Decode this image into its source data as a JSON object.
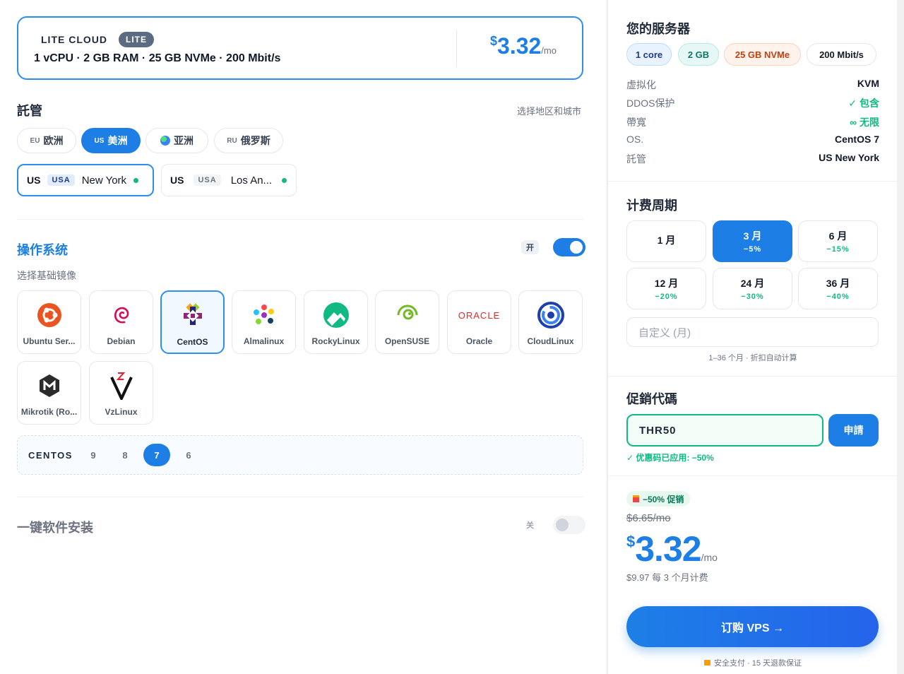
{
  "plan": {
    "name": "LITE CLOUD",
    "badge": "LITE",
    "specs": "1 vCPU · 2 GB RAM · 25 GB NVMe · 200 Mbit/s",
    "price_currency": "$",
    "price_amount": "3.32",
    "price_period": "/mo"
  },
  "hosting": {
    "title": "託管",
    "hint": "选择地区和城市",
    "regions": [
      {
        "code": "EU",
        "label": "欧洲",
        "active": false
      },
      {
        "code": "US",
        "label": "美洲",
        "active": true
      },
      {
        "code": "",
        "label": "亚洲",
        "active": false,
        "icon": "globe-icon"
      },
      {
        "code": "RU",
        "label": "俄罗斯",
        "active": false
      }
    ],
    "locations": [
      {
        "country": "US",
        "tag": "USA",
        "city": "New York",
        "active": true
      },
      {
        "country": "US",
        "tag": "USA",
        "city": "Los An...",
        "active": false
      }
    ]
  },
  "os": {
    "title": "操作系统",
    "toggle_label": "开",
    "toggle_on": true,
    "subtitle": "选择基础镜像",
    "items": [
      {
        "label": "Ubuntu Ser...",
        "icon": "ubuntu-icon"
      },
      {
        "label": "Debian",
        "icon": "debian-icon"
      },
      {
        "label": "CentOS",
        "icon": "centos-icon",
        "active": true
      },
      {
        "label": "Almalinux",
        "icon": "almalinux-icon"
      },
      {
        "label": "RockyLinux",
        "icon": "rockylinux-icon"
      },
      {
        "label": "OpenSUSE",
        "icon": "opensuse-icon"
      },
      {
        "label": "Oracle",
        "icon": "oracle-icon",
        "logo_text": "ORACLE"
      },
      {
        "label": "CloudLinux",
        "icon": "cloudlinux-icon"
      },
      {
        "label": "Mikrotik (Ro...",
        "icon": "mikrotik-icon"
      },
      {
        "label": "VzLinux",
        "icon": "vzlinux-icon"
      }
    ],
    "version_label": "CENTOS",
    "versions": [
      "9",
      "8",
      "7",
      "6"
    ],
    "selected_version": "7"
  },
  "software": {
    "title": "一键软件安装",
    "toggle_label": "关",
    "toggle_on": false
  },
  "summary": {
    "title": "您的服务器",
    "chips": [
      {
        "label": "1 core",
        "color": "#1e3a8a",
        "bg": "#e8f3ff",
        "border": "#bfdcfb"
      },
      {
        "label": "2 GB",
        "color": "#0f766e",
        "bg": "#e6f8f5",
        "border": "#b7ebe2"
      },
      {
        "label": "25 GB NVMe",
        "color": "#c2410c",
        "bg": "#fff3ec",
        "border": "#fbd3bd"
      },
      {
        "label": "200 Mbit/s",
        "color": "#111827",
        "bg": "#ffffff",
        "border": "#e5e7eb"
      }
    ],
    "rows": [
      {
        "key": "虚拟化",
        "value": "KVM",
        "green": false
      },
      {
        "key": "DDOS保护",
        "value": "✓ 包含",
        "green": true
      },
      {
        "key": "帶寬",
        "value": "∞ 无限",
        "green": true
      },
      {
        "key": "OS.",
        "value": "CentOS 7",
        "green": false
      },
      {
        "key": "託管",
        "value": "US New York",
        "green": false
      }
    ]
  },
  "billing": {
    "title": "计费周期",
    "periods": [
      {
        "label": "1 月",
        "discount": "",
        "active": false
      },
      {
        "label": "3 月",
        "discount": "−5%",
        "active": true
      },
      {
        "label": "6 月",
        "discount": "−15%",
        "active": false
      },
      {
        "label": "12 月",
        "discount": "−20%",
        "active": false
      },
      {
        "label": "24 月",
        "discount": "−30%",
        "active": false
      },
      {
        "label": "36 月",
        "discount": "−40%",
        "active": false
      }
    ],
    "custom_placeholder": "自定义 (月)",
    "custom_hint": "1–36 个月 · 折扣自动计算"
  },
  "promo": {
    "title": "促銷代碼",
    "code": "THR50",
    "apply_label": "申請",
    "status": "✓ 优惠码已应用: −50%"
  },
  "total": {
    "sale_label": "−50% 促销",
    "old_price": "$6.65/mo",
    "currency": "$",
    "amount": "3.32",
    "period": "/mo",
    "bill_note": "$9.97 每 3 个月计费",
    "order_label": "订购 VPS →",
    "secure_note": "安全支付 · 15 天退款保证"
  },
  "colors": {
    "accent": "#1d7fe6",
    "success": "#10b981"
  }
}
